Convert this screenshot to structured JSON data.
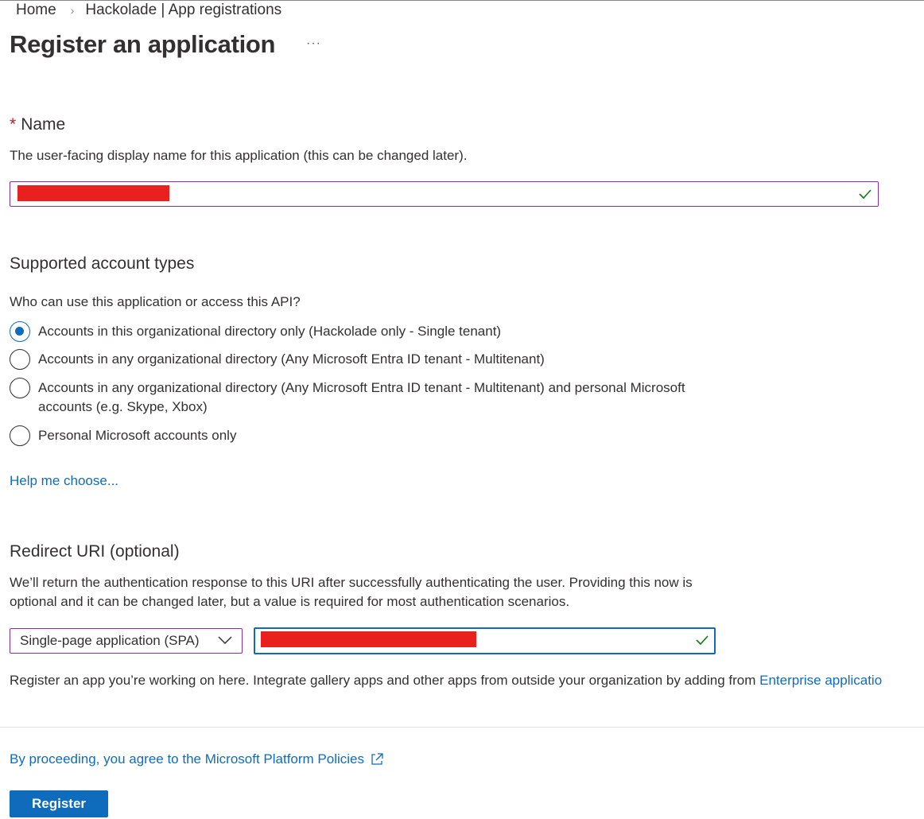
{
  "breadcrumb": {
    "home": "Home",
    "separator": "›",
    "current": "Hackolade | App registrations"
  },
  "page": {
    "title": "Register an application",
    "more_label": "···"
  },
  "name_section": {
    "required_marker": "*",
    "heading": "Name",
    "description": "The user-facing display name for this application (this can be changed later).",
    "input_value": ""
  },
  "account_section": {
    "heading": "Supported account types",
    "question": "Who can use this application or access this API?",
    "options": [
      {
        "line1": "Accounts in this organizational directory only (Hackolade only - Single tenant)",
        "line2": "",
        "selected": true
      },
      {
        "line1": "Accounts in any organizational directory (Any Microsoft Entra ID tenant - Multitenant)",
        "line2": "",
        "selected": false
      },
      {
        "line1": "Accounts in any organizational directory (Any Microsoft Entra ID tenant - Multitenant) and personal Microsoft",
        "line2": "accounts (e.g. Skype, Xbox)",
        "selected": false
      },
      {
        "line1": "Personal Microsoft accounts only",
        "line2": "",
        "selected": false
      }
    ],
    "help_link": "Help me choose..."
  },
  "redirect_section": {
    "heading": "Redirect URI (optional)",
    "description_line1": "We’ll return the authentication response to this URI after successfully authenticating the user. Providing this now is",
    "description_line2": "optional and it can be changed later, but a value is required for most authentication scenarios.",
    "platform_selected": "Single-page application (SPA)",
    "uri_value": ""
  },
  "enterprise": {
    "text": "Register an app you’re working on here. Integrate gallery apps and other apps from outside your organization by adding from ",
    "link": "Enterprise applicatio"
  },
  "footer": {
    "policy_link": "By proceeding, you agree to the Microsoft Platform Policies",
    "register_label": "Register"
  },
  "colors": {
    "accent": "#0f6cbd",
    "input_border": "#8b2ea3",
    "valid_check": "#107c10",
    "redaction": "#e8211f"
  },
  "icons": {
    "valid": "checkmark-icon",
    "dropdown": "chevron-down-icon",
    "external": "external-link-icon"
  }
}
